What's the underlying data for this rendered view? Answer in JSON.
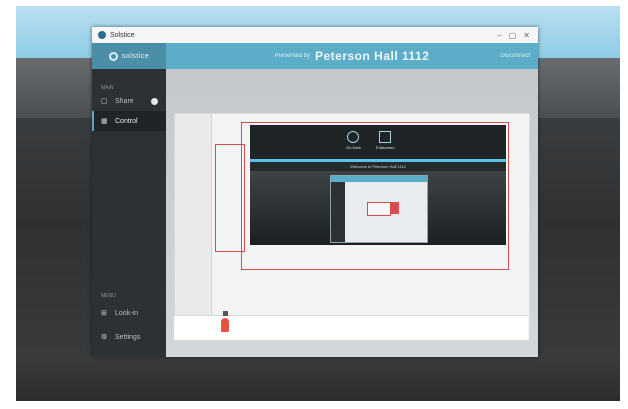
{
  "window": {
    "title": "Solstice",
    "controls": [
      "–",
      "▢",
      "✕"
    ]
  },
  "sidebar": {
    "logo_text": "solstice",
    "section_top": "MAIN",
    "items": [
      {
        "label": "Share",
        "icon": "▢"
      },
      {
        "label": "Control",
        "icon": "▦"
      }
    ],
    "section_bottom": "MENU",
    "bottom_items": [
      {
        "label": "Look-in",
        "icon": "⊞"
      },
      {
        "label": "Settings",
        "icon": "⚙"
      }
    ]
  },
  "header": {
    "presented_label": "Presented by",
    "room": "Peterson Hall 1112",
    "disconnect": "Disconnect"
  },
  "shared_screen": {
    "controls": [
      {
        "label": "Go Dark",
        "icon": "circle-icon"
      },
      {
        "label": "Fullscreen",
        "icon": "fullscreen-icon"
      }
    ],
    "welcome_text": "Welcome to Peterson Hall 1112"
  },
  "colors": {
    "accent": "#5cadc8",
    "sidebar_bg": "#2c3133",
    "selection_red": "#d94b4b",
    "pin_red": "#e5533f"
  }
}
